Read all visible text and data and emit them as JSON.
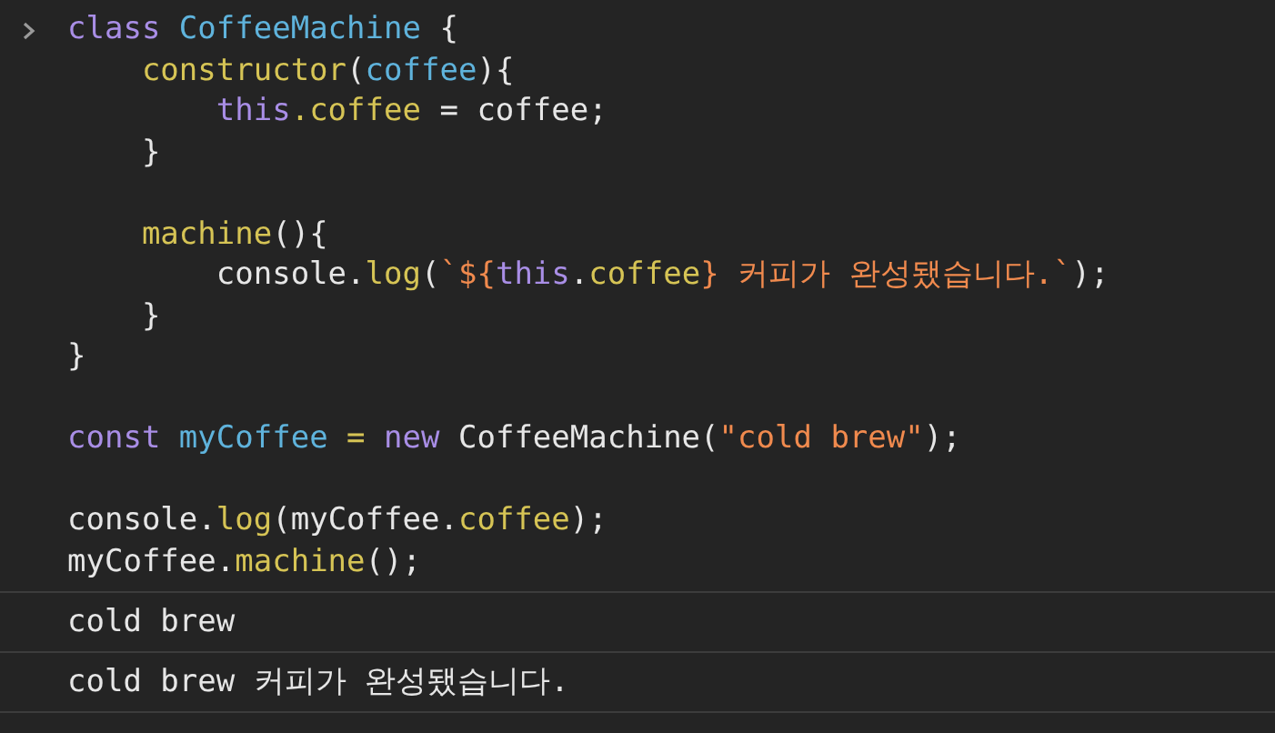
{
  "console": {
    "input": {
      "lines": [
        {
          "kind": "code",
          "tokens": [
            {
              "text": "class ",
              "kind": "keyword"
            },
            {
              "text": "CoffeeMachine",
              "kind": "name"
            },
            {
              "text": " {",
              "kind": "plain"
            }
          ]
        },
        {
          "kind": "code",
          "tokens": [
            {
              "text": "    constructor",
              "kind": "member"
            },
            {
              "text": "(",
              "kind": "plain"
            },
            {
              "text": "coffee",
              "kind": "name"
            },
            {
              "text": "){",
              "kind": "plain"
            }
          ]
        },
        {
          "kind": "code",
          "tokens": [
            {
              "text": "        this",
              "kind": "keyword"
            },
            {
              "text": ".coffee",
              "kind": "member"
            },
            {
              "text": " = coffee;",
              "kind": "plain"
            }
          ]
        },
        {
          "kind": "code",
          "tokens": [
            {
              "text": "    }",
              "kind": "plain"
            }
          ]
        },
        {
          "kind": "blank"
        },
        {
          "kind": "code",
          "tokens": [
            {
              "text": "    machine",
              "kind": "member"
            },
            {
              "text": "(){",
              "kind": "plain"
            }
          ]
        },
        {
          "kind": "code",
          "tokens": [
            {
              "text": "        console.",
              "kind": "plain"
            },
            {
              "text": "log",
              "kind": "member"
            },
            {
              "text": "(",
              "kind": "plain"
            },
            {
              "text": "`${",
              "kind": "string"
            },
            {
              "text": "this",
              "kind": "keyword"
            },
            {
              "text": ".",
              "kind": "plain"
            },
            {
              "text": "coffee",
              "kind": "member"
            },
            {
              "text": "}",
              "kind": "string"
            },
            {
              "text": " 커피가 완성됐습니다.`",
              "kind": "string"
            },
            {
              "text": ");",
              "kind": "plain"
            }
          ]
        },
        {
          "kind": "code",
          "tokens": [
            {
              "text": "    }",
              "kind": "plain"
            }
          ]
        },
        {
          "kind": "code",
          "tokens": [
            {
              "text": "}",
              "kind": "plain"
            }
          ]
        },
        {
          "kind": "blank"
        },
        {
          "kind": "code",
          "tokens": [
            {
              "text": "const ",
              "kind": "keyword"
            },
            {
              "text": "myCoffee",
              "kind": "name"
            },
            {
              "text": " = ",
              "kind": "member"
            },
            {
              "text": "new ",
              "kind": "keyword"
            },
            {
              "text": "CoffeeMachine(",
              "kind": "plain"
            },
            {
              "text": "\"cold brew\"",
              "kind": "string"
            },
            {
              "text": ");",
              "kind": "plain"
            }
          ]
        },
        {
          "kind": "blank"
        },
        {
          "kind": "code",
          "tokens": [
            {
              "text": "console.",
              "kind": "plain"
            },
            {
              "text": "log",
              "kind": "member"
            },
            {
              "text": "(myCoffee.",
              "kind": "plain"
            },
            {
              "text": "coffee",
              "kind": "member"
            },
            {
              "text": ");",
              "kind": "plain"
            }
          ]
        },
        {
          "kind": "code",
          "tokens": [
            {
              "text": "myCoffee.",
              "kind": "plain"
            },
            {
              "text": "machine",
              "kind": "member"
            },
            {
              "text": "();",
              "kind": "plain"
            }
          ]
        }
      ]
    },
    "outputs": [
      "cold brew",
      "cold brew 커피가 완성됐습니다."
    ]
  }
}
